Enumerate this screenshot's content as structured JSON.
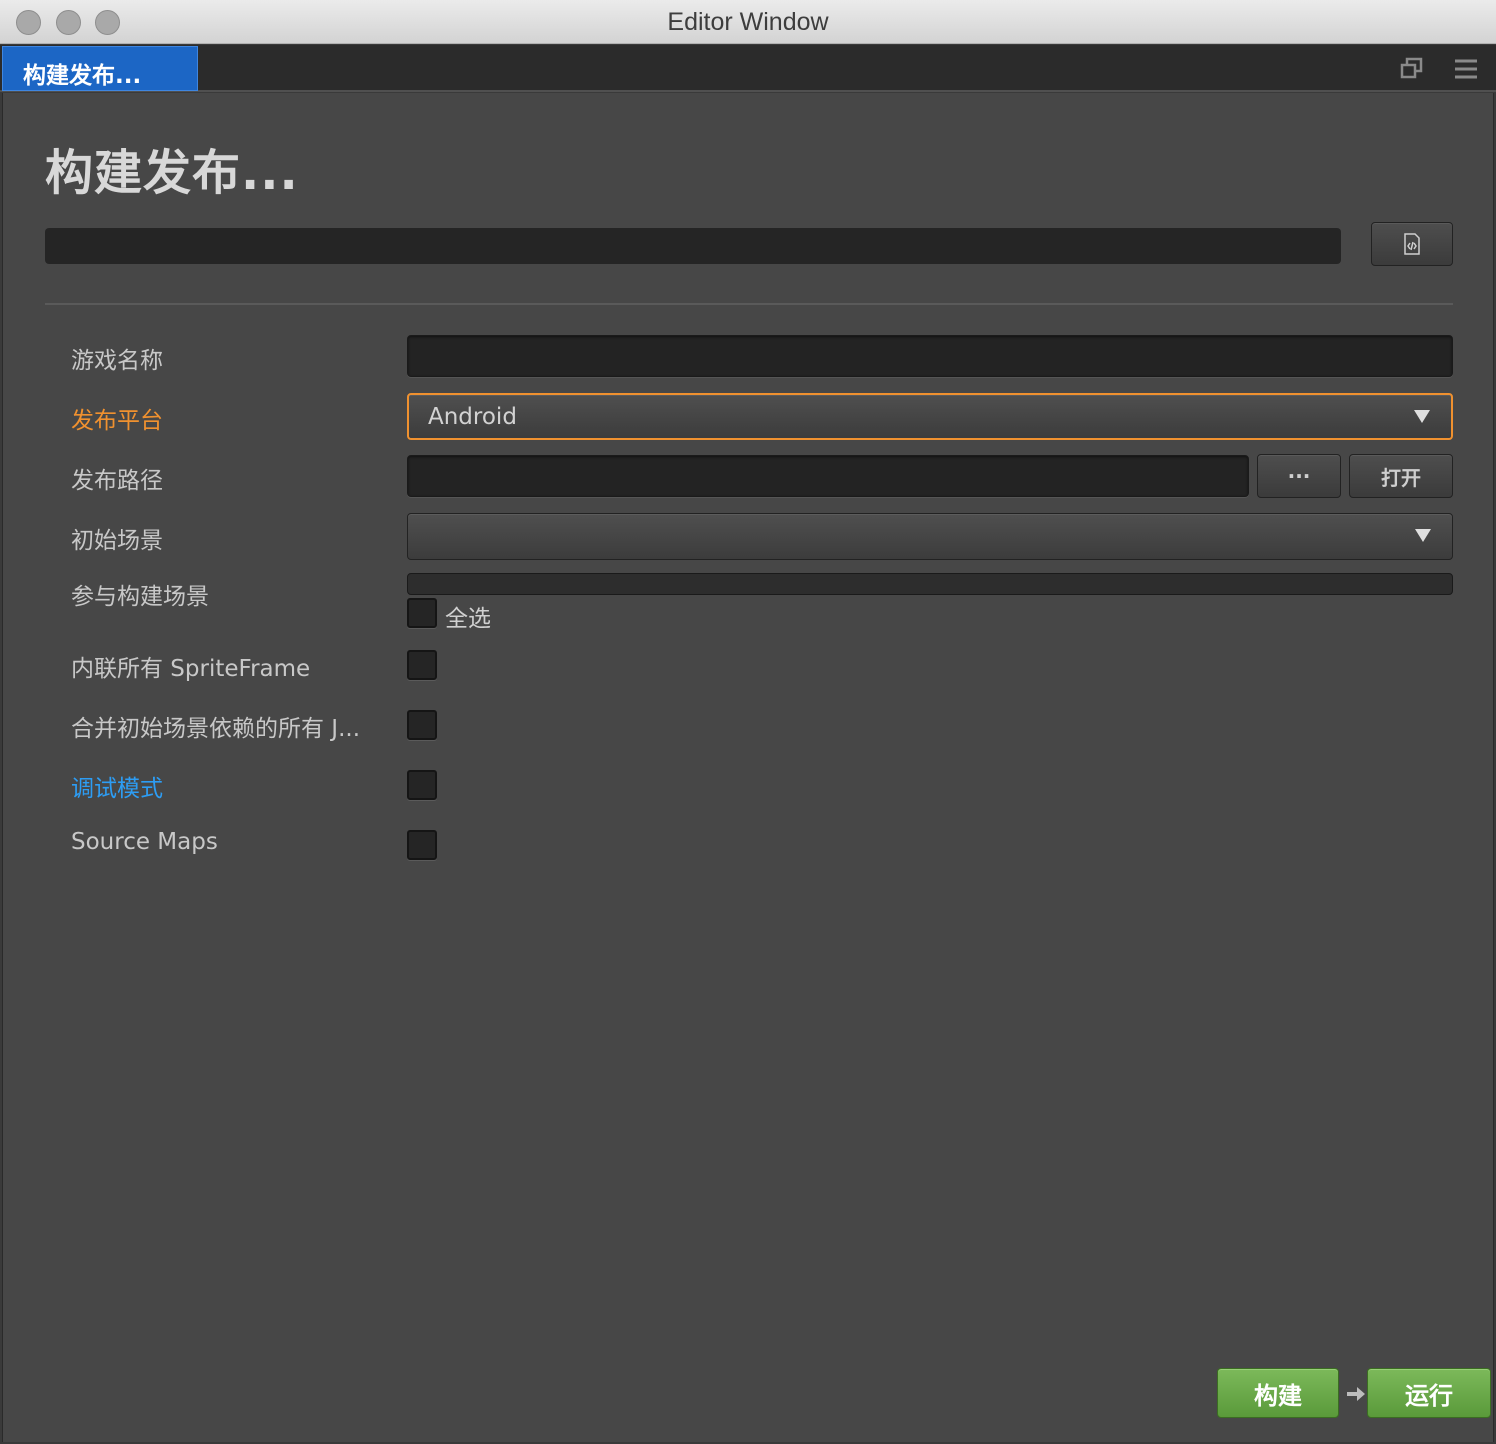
{
  "window": {
    "title": "Editor Window"
  },
  "tab": {
    "label": "构建发布..."
  },
  "toolbar_icons": {
    "popout": "popout-icon",
    "menu": "hamburger-menu-icon"
  },
  "panel": {
    "title": "构建发布...",
    "progress": 0,
    "log_button_icon": "code-file-icon"
  },
  "form": {
    "game_name": {
      "label": "游戏名称",
      "value": ""
    },
    "platform": {
      "label": "发布平台",
      "value": "Android",
      "accent": "#f0912f"
    },
    "build_path": {
      "label": "发布路径",
      "value": "",
      "browse_label": "···",
      "open_label": "打开"
    },
    "start_scene": {
      "label": "初始场景",
      "value": ""
    },
    "included_scenes": {
      "label": "参与构建场景",
      "select_all_label": "全选",
      "select_all_checked": false
    },
    "inline_spriteframes": {
      "label": "内联所有 SpriteFrame",
      "checked": false
    },
    "merge_start_scene": {
      "label": "合并初始场景依赖的所有 J...",
      "checked": false
    },
    "debug": {
      "label": "调试模式",
      "checked": false,
      "accent": "#2d9df4"
    },
    "source_maps": {
      "label": "Source Maps",
      "checked": false
    }
  },
  "actions": {
    "build_label": "构建",
    "run_label": "运行",
    "color": "#6aab48"
  }
}
